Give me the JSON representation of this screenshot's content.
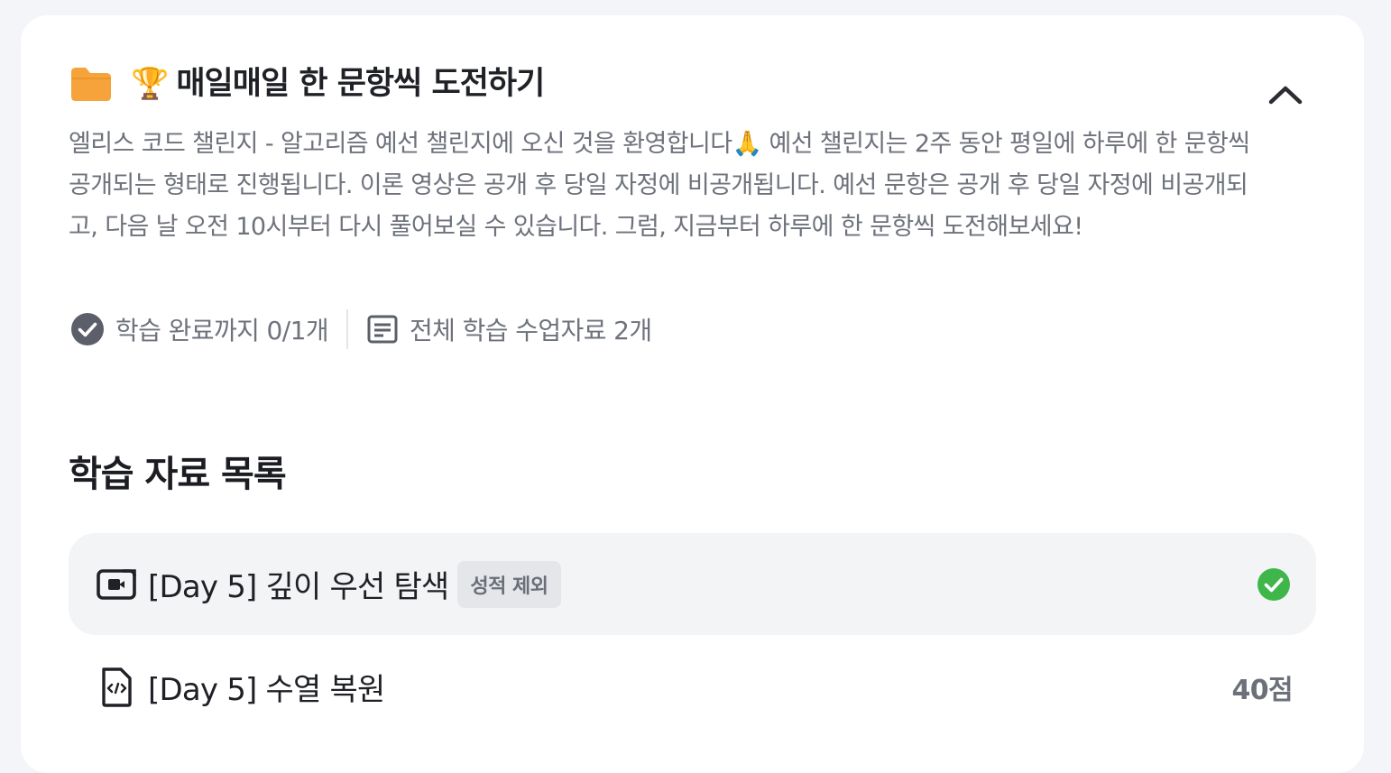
{
  "section": {
    "icons": {
      "folder": "folder-icon",
      "trophy": "trophy-emoji"
    },
    "trophy_glyph": "🏆",
    "title": "매일매일 한 문항씩 도전하기",
    "collapse_icon": "chevron-up-icon",
    "description": "엘리스 코드 챌린지 - 알고리즘 예선 챌린지에 오신 것을 환영합니다🙏 예선 챌린지는 2주 동안 평일에 하루에 한 문항씩 공개되는 형태로 진행됩니다. 이론 영상은 공개 후 당일 자정에 비공개됩니다. 예선 문항은 공개 후 당일 자정에 비공개되고, 다음 날 오전 10시부터 다시 풀어보실 수 있습니다. 그럼, 지금부터 하루에 한 문항씩 도전해보세요!",
    "progress_label": "학습 완료까지 0/1개",
    "materials_label": "전체 학습 수업자료 2개"
  },
  "list": {
    "heading": "학습 자료 목록",
    "items": [
      {
        "icon": "video-icon",
        "title": "[Day 5] 깊이 우선 탐색",
        "badge": "성적 제외",
        "status_icon": "check-circle-icon",
        "status_color": "#3fb64a"
      },
      {
        "icon": "code-file-icon",
        "title": "[Day 5] 수열 복원",
        "score": "40점"
      }
    ]
  },
  "colors": {
    "folder": "#f5a33a",
    "background": "#f4f5f9",
    "card": "#ffffff",
    "muted_text": "#6e727b",
    "check_green": "#3fb64a"
  }
}
